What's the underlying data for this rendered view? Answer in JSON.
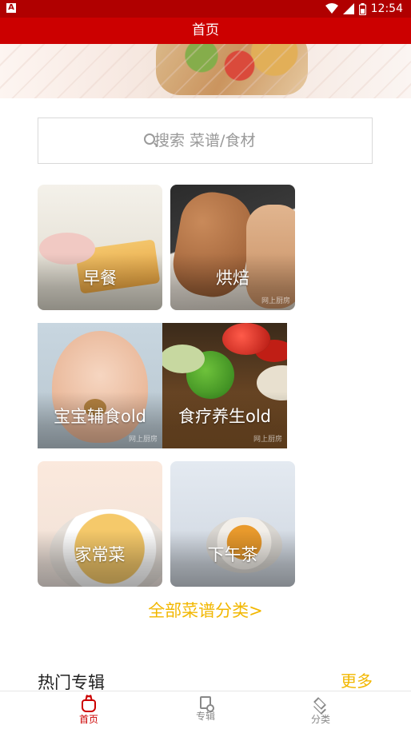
{
  "status_bar": {
    "left_icon": "notification-a-icon",
    "left_glyph": "A",
    "time": "12:54",
    "icons": [
      "wifi-icon",
      "signal-icon",
      "battery-icon"
    ]
  },
  "header": {
    "title": "首页"
  },
  "search": {
    "placeholder": "搜索 菜谱/食材",
    "icon": "search-icon"
  },
  "categories": [
    {
      "label": "早餐",
      "watermark": ""
    },
    {
      "label": "烘焙",
      "watermark": "网上厨房"
    },
    {
      "label": "宝宝辅食old",
      "watermark": "网上厨房"
    },
    {
      "label": "食疗养生old",
      "watermark": "网上厨房"
    },
    {
      "label": "家常菜",
      "watermark": ""
    },
    {
      "label": "下午茶",
      "watermark": ""
    }
  ],
  "all_categories_link": "全部菜谱分类>",
  "hot_section": {
    "title": "热门专辑",
    "more": "更多"
  },
  "bottom_nav": [
    {
      "label": "首页",
      "icon": "home-icon",
      "active": true
    },
    {
      "label": "专辑",
      "icon": "album-icon",
      "active": false
    },
    {
      "label": "分类",
      "icon": "layers-icon",
      "active": false
    }
  ],
  "colors": {
    "title_bar": "#cc0000",
    "status_bar": "#b00000",
    "accent": "#f2b700"
  }
}
